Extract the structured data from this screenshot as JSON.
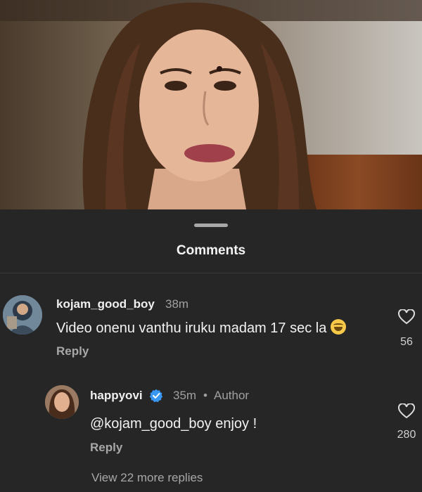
{
  "sheet": {
    "title": "Comments"
  },
  "comments": [
    {
      "username": "kojam_good_boy",
      "time": "38m",
      "text": "Video onenu vanthu iruku madam 17 sec la",
      "emoji": "laughing-tears-emoji",
      "reply_label": "Reply",
      "likes": "56"
    }
  ],
  "replies": [
    {
      "username": "happyovi",
      "time": "35m",
      "separator": "•",
      "role": "Author",
      "text": "@kojam_good_boy enjoy !",
      "reply_label": "Reply",
      "likes": "280",
      "verified": true
    }
  ],
  "view_more": "View 22 more replies",
  "colors": {
    "background": "#262626",
    "verified": "#3897f0",
    "muted": "#a8a8a8"
  }
}
